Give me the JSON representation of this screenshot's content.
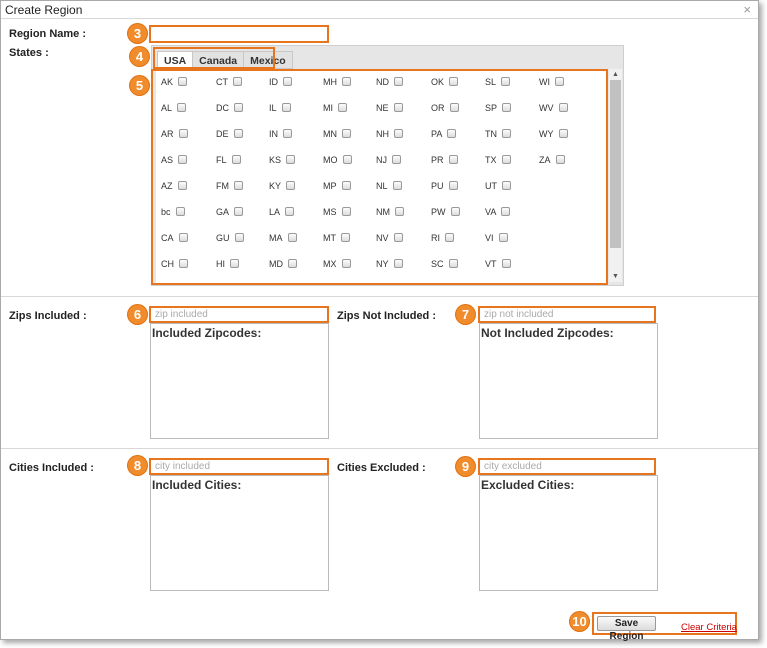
{
  "dialog": {
    "title": "Create Region",
    "close_glyph": "×"
  },
  "form": {
    "region_name_label": "Region Name :",
    "region_name_value": "",
    "states_label": "States :",
    "zips_included_label": "Zips Included :",
    "zips_included_placeholder": "zip included",
    "zips_included_box_title": "Included Zipcodes:",
    "zips_not_included_label": "Zips Not Included :",
    "zips_not_included_placeholder": "zip not included",
    "zips_not_included_box_title": "Not Included Zipcodes:",
    "cities_included_label": "Cities Included :",
    "cities_included_placeholder": "city included",
    "cities_included_box_title": "Included Cities:",
    "cities_excluded_label": "Cities Excluded :",
    "cities_excluded_placeholder": "city excluded",
    "cities_excluded_box_title": "Excluded Cities:"
  },
  "tabs": [
    {
      "label": "USA",
      "active": true
    },
    {
      "label": "Canada",
      "active": false
    },
    {
      "label": "Mexico",
      "active": false
    }
  ],
  "states_columns": [
    [
      "AK",
      "AL",
      "AR",
      "AS",
      "AZ",
      "bc",
      "CA",
      "CH"
    ],
    [
      "CT",
      "DC",
      "DE",
      "FL",
      "FM",
      "GA",
      "GU",
      "HI"
    ],
    [
      "ID",
      "IL",
      "IN",
      "KS",
      "KY",
      "LA",
      "MA",
      "MD"
    ],
    [
      "MH",
      "MI",
      "MN",
      "MO",
      "MP",
      "MS",
      "MT",
      "MX"
    ],
    [
      "ND",
      "NE",
      "NH",
      "NJ",
      "NL",
      "NM",
      "NV",
      "NY"
    ],
    [
      "OK",
      "OR",
      "PA",
      "PR",
      "PU",
      "PW",
      "RI",
      "SC"
    ],
    [
      "SL",
      "SP",
      "TN",
      "TX",
      "UT",
      "VA",
      "VI",
      "VT"
    ],
    [
      "WI",
      "WV",
      "WY",
      "ZA"
    ]
  ],
  "callouts": [
    "3",
    "4",
    "5",
    "6",
    "7",
    "8",
    "9",
    "10"
  ],
  "actions": {
    "save_label": "Save Region",
    "clear_label": "Clear Criteria"
  },
  "colors": {
    "highlight": "#e8741e",
    "badge": "#f08c2c",
    "link": "#cc0000"
  },
  "icons": {
    "scroll_up": "▲",
    "scroll_down": "▼"
  }
}
